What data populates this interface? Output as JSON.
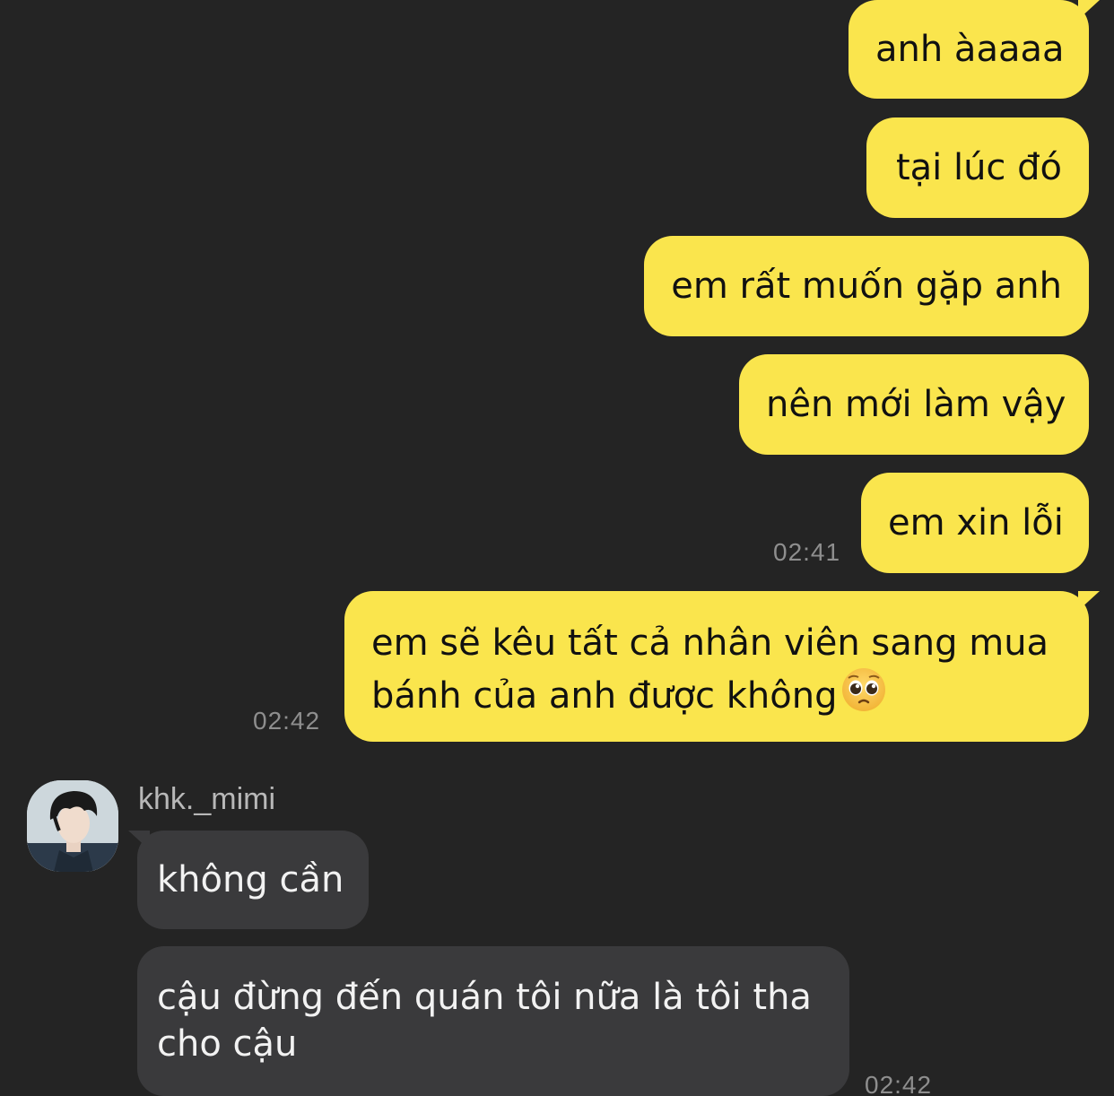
{
  "outgoing": [
    {
      "text": "anh àaaaa"
    },
    {
      "text": "tại lúc đó"
    },
    {
      "text": "em rất muốn gặp anh"
    },
    {
      "text": "nên mới làm vậy"
    },
    {
      "text": "em xin lỗi",
      "time": "02:41"
    },
    {
      "line1": "em sẽ kêu tất cả nhân viên sang mua",
      "line2": "bánh của anh được không",
      "emoji": "pleading-face-emoji",
      "time": "02:42"
    }
  ],
  "incoming": {
    "sender": "khk._mimi",
    "avatar": "profile-photo",
    "messages": [
      {
        "text": "không cần"
      },
      {
        "line1": "cậu đừng đến quán tôi nữa là tôi tha",
        "line2": "cho cậu",
        "time": "02:42"
      }
    ]
  },
  "colors": {
    "background": "#242424",
    "outgoing_bubble": "#fae54d",
    "incoming_bubble": "#3a3a3c",
    "timestamp": "#8e8e8e"
  }
}
